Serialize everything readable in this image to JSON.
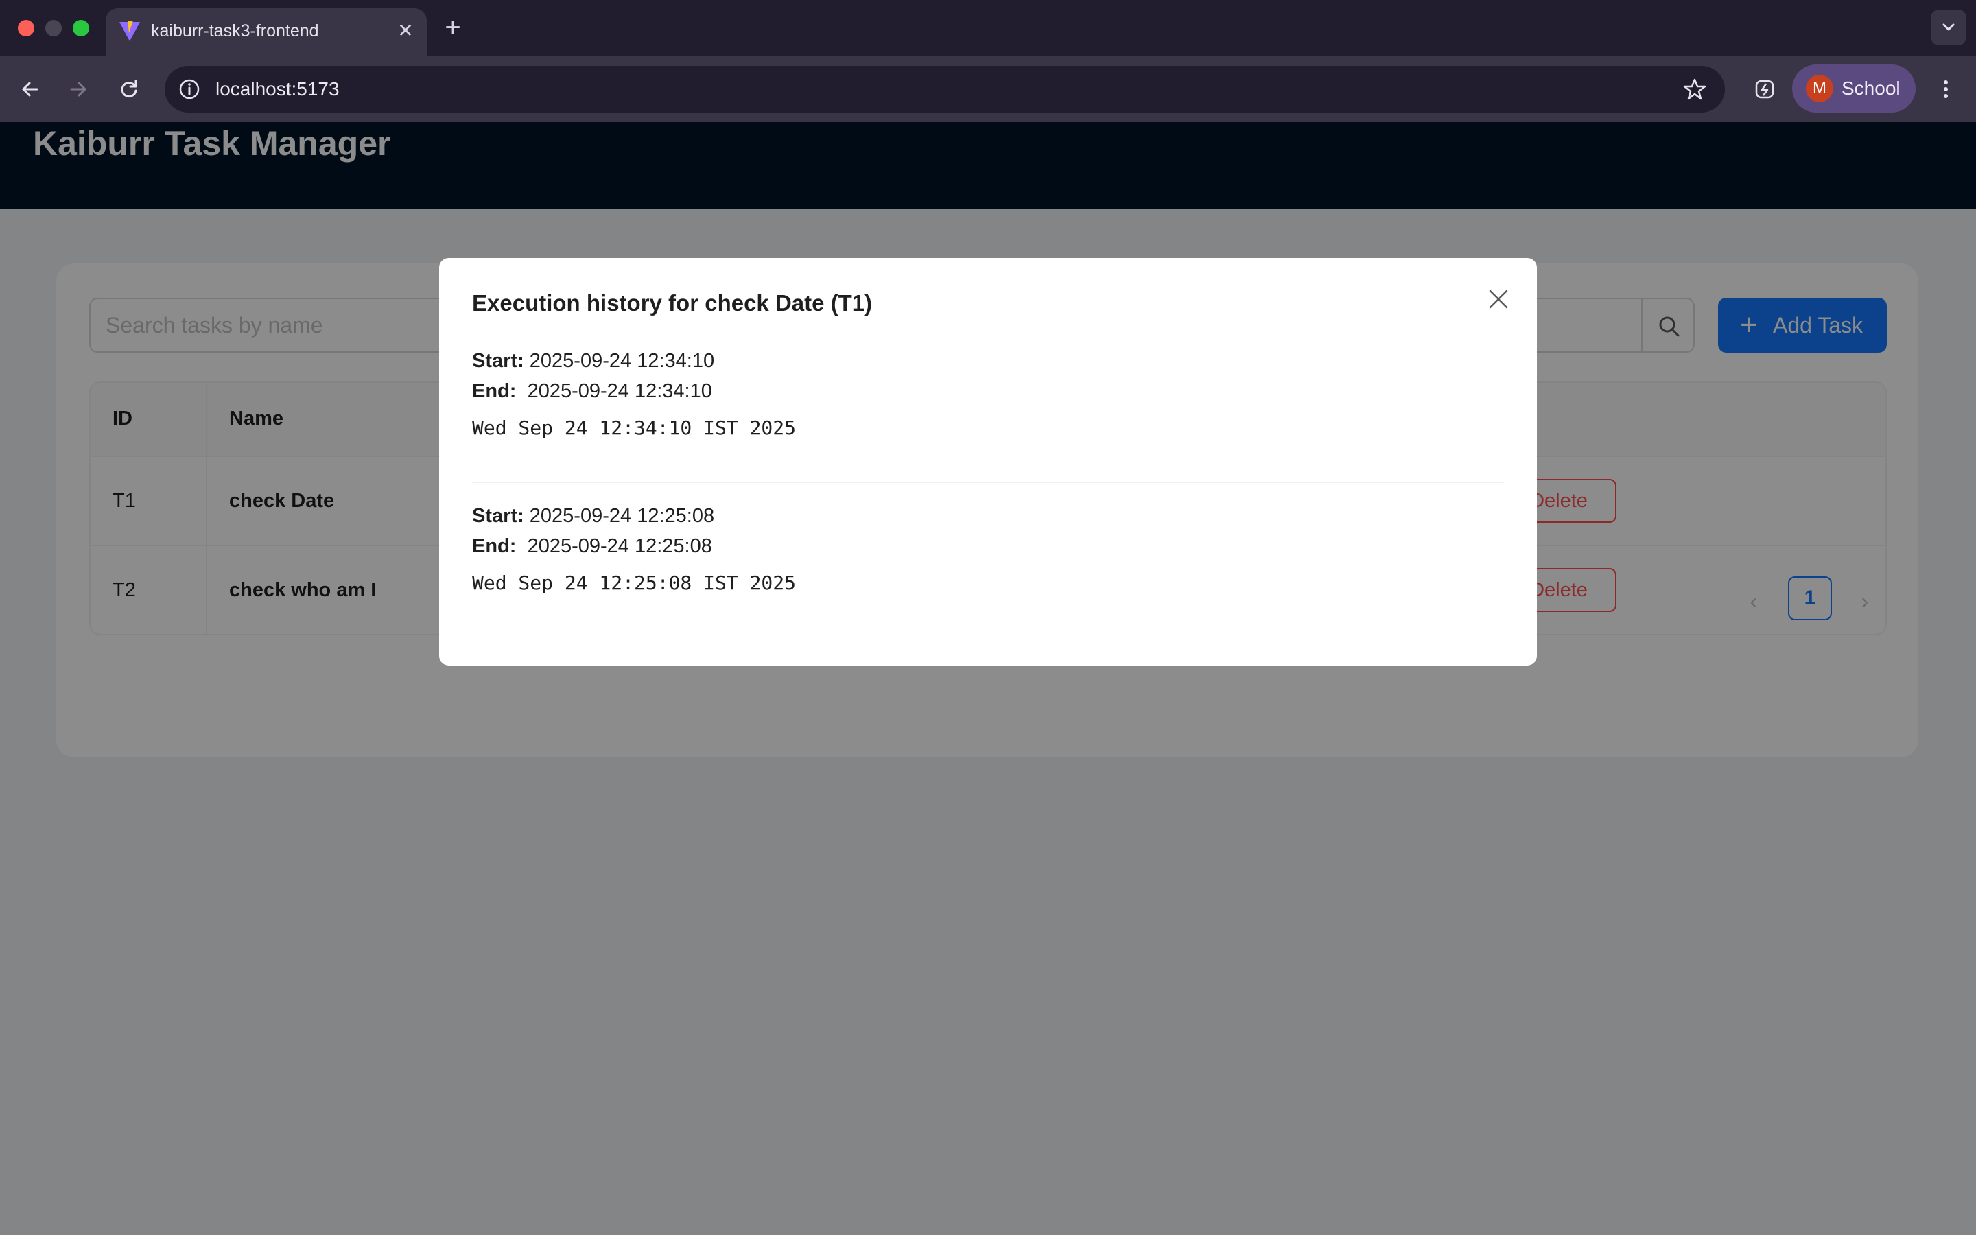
{
  "browser": {
    "tab_title": "kaiburr-task3-frontend",
    "tab_close": "✕",
    "new_tab": "+",
    "url": "localhost:5173",
    "profile_initial": "M",
    "profile_label": "School"
  },
  "app": {
    "title": "Kaiburr Task Manager",
    "search_placeholder": "Search tasks by name",
    "add_task_label": "Add Task",
    "columns": [
      "ID",
      "Name"
    ],
    "rows": [
      {
        "id": "T1",
        "name": "check Date",
        "action": "Delete"
      },
      {
        "id": "T2",
        "name": "check who am I",
        "action": "Delete"
      }
    ],
    "pagination": {
      "current_page": "1",
      "prev": "‹",
      "next": "›"
    }
  },
  "modal": {
    "title": "Execution history for check Date (T1)",
    "start_label": "Start:",
    "end_label": "End:",
    "executions": [
      {
        "start": "2025-09-24 12:34:10",
        "end": "2025-09-24 12:34:10",
        "output": "Wed Sep 24 12:34:10 IST 2025"
      },
      {
        "start": "2025-09-24 12:25:08",
        "end": "2025-09-24 12:25:08",
        "output": "Wed Sep 24 12:25:08 IST 2025"
      }
    ]
  },
  "colors": {
    "primary": "#1677ff",
    "danger": "#ff4d4f",
    "header_bg": "#001529",
    "chrome_bg": "#211c2e"
  }
}
